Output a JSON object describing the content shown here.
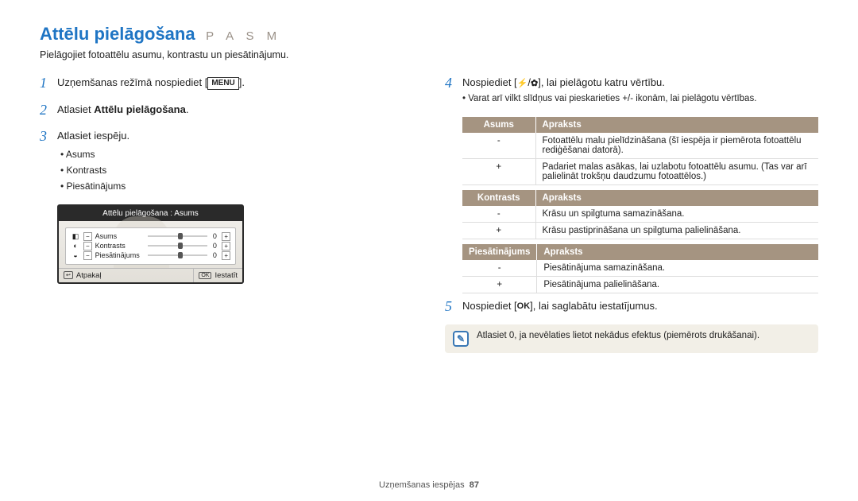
{
  "title": "Attēlu pielāgošana",
  "modes": "P A S M",
  "subtitle": "Pielāgojiet fotoattēlu asumu, kontrastu un piesātinājumu.",
  "left": {
    "step1": {
      "text": "Uzņemšanas režīmā nospiediet [",
      "icon": "MENU",
      "after": "]."
    },
    "step2": {
      "prefix": "Atlasiet ",
      "bold": "Attēlu pielāgošana",
      "suffix": "."
    },
    "step3": {
      "text": "Atlasiet iespēju.",
      "bullets": [
        "Asums",
        "Kontrasts",
        "Piesātinājums"
      ]
    },
    "screen": {
      "header": "Attēlu pielāgošana : Asums",
      "rows": [
        {
          "icon": "◧",
          "label": "Asums",
          "val": "0"
        },
        {
          "icon": "◐",
          "label": "Kontrasts",
          "val": "0"
        },
        {
          "icon": "◒",
          "label": "Piesātinājums",
          "val": "0"
        }
      ],
      "back_icon": "↩",
      "back_label": "Atpakaļ",
      "ok_icon": "OK",
      "ok_label": "Iestatīt"
    }
  },
  "right": {
    "step4": {
      "text_before": "Nospiediet [",
      "icon1": "⚡",
      "sep": "/",
      "icon2": "✿",
      "text_after": "], lai pielāgotu katru vērtību.",
      "bullet": "Varat arī vilkt slīdņus vai pieskarieties +/- ikonām, lai pielāgotu vērtības."
    },
    "tables": [
      {
        "h1": "Asums",
        "h2": "Apraksts",
        "rows": [
          {
            "k": "-",
            "v": "Fotoattēlu malu pielīdzināšana (šī iespēja ir piemērota fotoattēlu rediģēšanai datorā)."
          },
          {
            "k": "+",
            "v": "Padariet malas asākas, lai uzlabotu fotoattēlu asumu. (Tas var arī palielināt trokšņu daudzumu fotoattēlos.)"
          }
        ]
      },
      {
        "h1": "Kontrasts",
        "h2": "Apraksts",
        "rows": [
          {
            "k": "-",
            "v": "Krāsu un spilgtuma samazināšana."
          },
          {
            "k": "+",
            "v": "Krāsu pastiprināšana un spilgtuma palielināšana."
          }
        ]
      },
      {
        "h1": "Piesātinājums",
        "h2": "Apraksts",
        "rows": [
          {
            "k": "-",
            "v": "Piesātinājuma samazināšana."
          },
          {
            "k": "+",
            "v": "Piesātinājuma palielināšana."
          }
        ]
      }
    ],
    "step5": {
      "before": "Nospiediet [",
      "ok": "OK",
      "after": "], lai saglabātu iestatījumus."
    },
    "note": "Atlasiet 0, ja nevēlaties lietot nekādus efektus (piemērots drukāšanai)."
  },
  "footer": {
    "section": "Uzņemšanas iespējas",
    "page": "87"
  }
}
